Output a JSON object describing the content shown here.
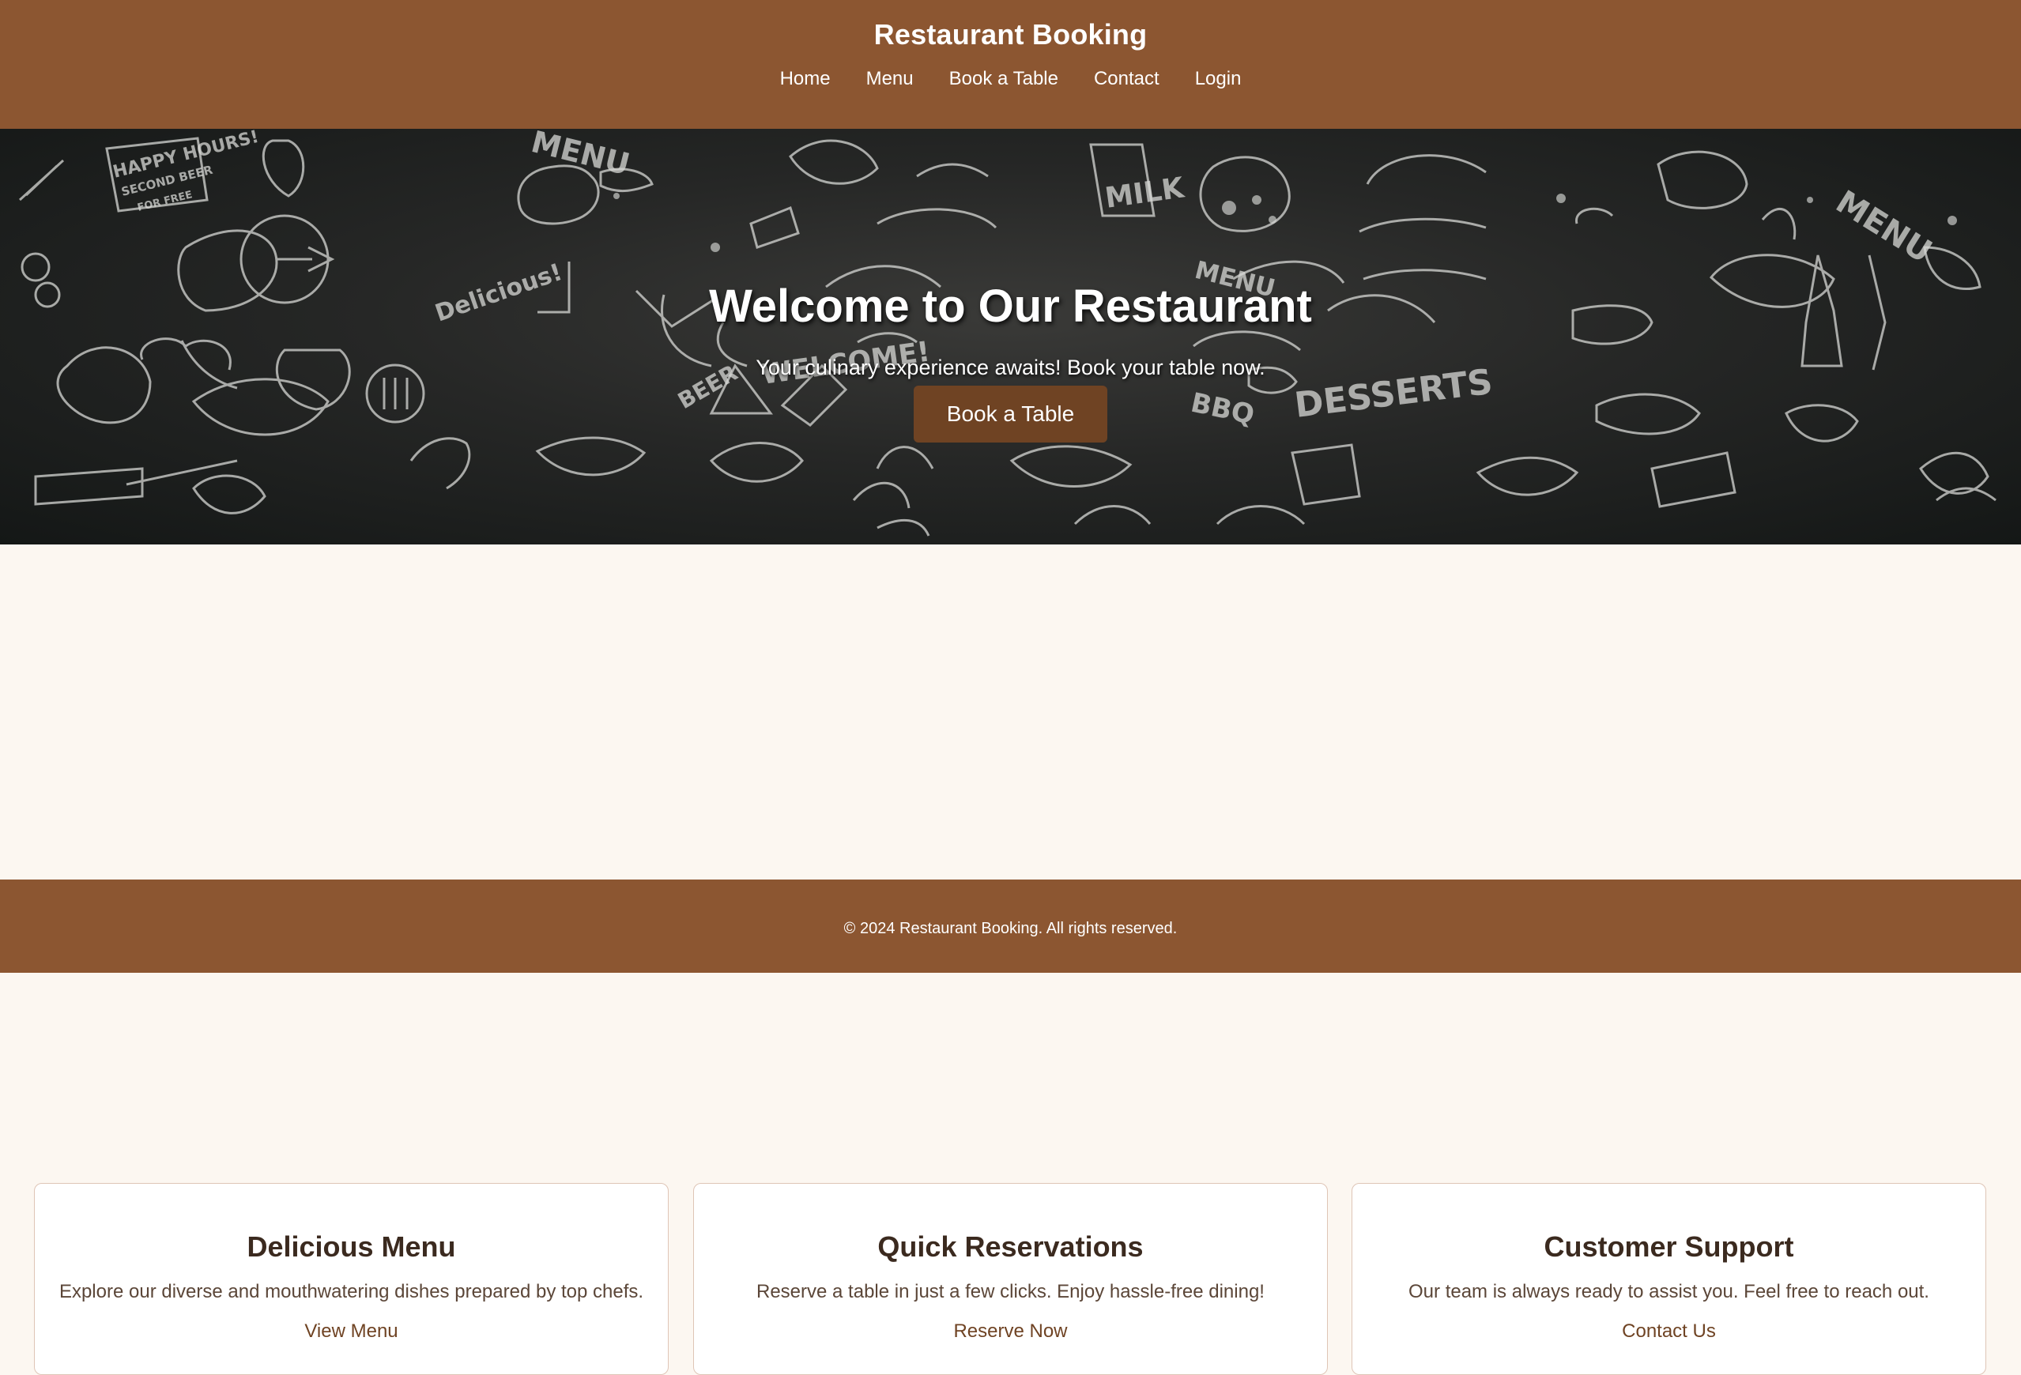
{
  "header": {
    "title": "Restaurant Booking",
    "nav": [
      "Home",
      "Menu",
      "Book a Table",
      "Contact",
      "Login"
    ]
  },
  "hero": {
    "title": "Welcome to Our Restaurant",
    "subtitle": "Your culinary experience awaits! Book your table now.",
    "button_label": "Book a Table",
    "background_words": {
      "happy_hours": "HAPPY HOURS!",
      "second_beer": "SECOND BEER",
      "for_free": "FOR FREE",
      "menu_left": "MENU",
      "delicious": "Delicious!",
      "beer": "BEER",
      "welcome": "WELCOME!",
      "milk": "MILK",
      "menu_round": "MENU",
      "bbq": "BBQ",
      "desserts": "DESSERTS",
      "menu_right": "MENU"
    }
  },
  "features": [
    {
      "title": "Delicious Menu",
      "text": "Explore our diverse and mouthwatering dishes prepared by top chefs.",
      "link": "View Menu"
    },
    {
      "title": "Quick Reservations",
      "text": "Reserve a table in just a few clicks. Enjoy hassle-free dining!",
      "link": "Reserve Now"
    },
    {
      "title": "Customer Support",
      "text": "Our team is always ready to assist you. Feel free to reach out.",
      "link": "Contact Us"
    }
  ],
  "footer": {
    "text": "© 2024 Restaurant Booking. All rights reserved."
  },
  "colors": {
    "header_bg": "#8c5631",
    "hero_button_bg": "#6f4323",
    "page_bg": "#fcf7f1",
    "card_border": "#dfc5b6"
  },
  "icons": {
    "hero_background": "food-doodle-pattern"
  }
}
